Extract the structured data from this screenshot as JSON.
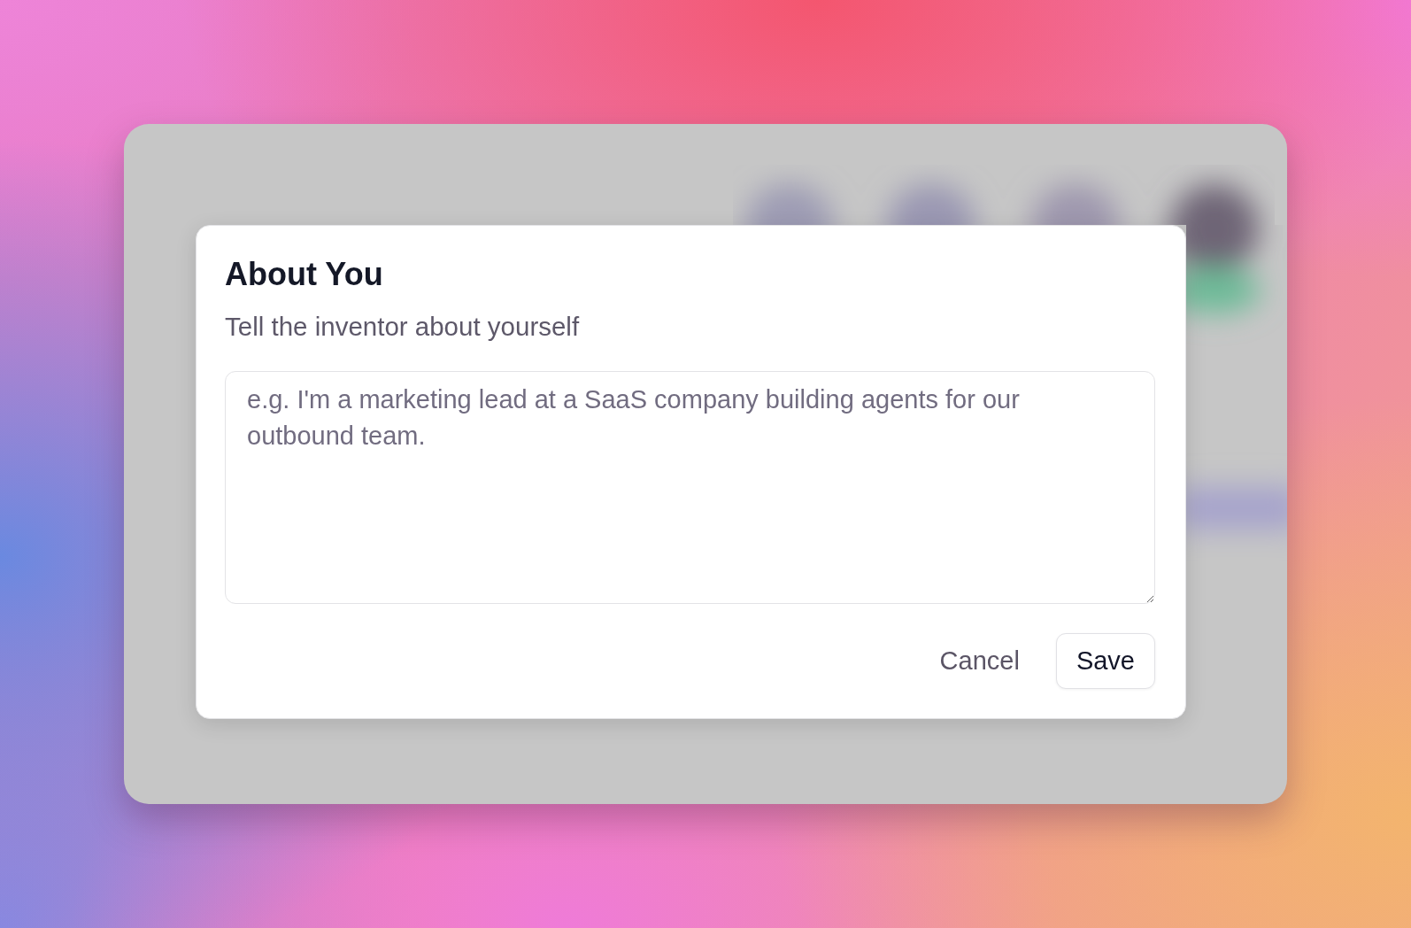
{
  "dialog": {
    "title": "About You",
    "subtitle": "Tell the inventor about yourself",
    "about_field": {
      "placeholder": "e.g. I'm a marketing lead at a SaaS company building agents for our outbound team."
    },
    "buttons": [
      {
        "label": "Cancel",
        "kind": "ghost"
      },
      {
        "label": "Save",
        "kind": "outlined"
      }
    ]
  }
}
